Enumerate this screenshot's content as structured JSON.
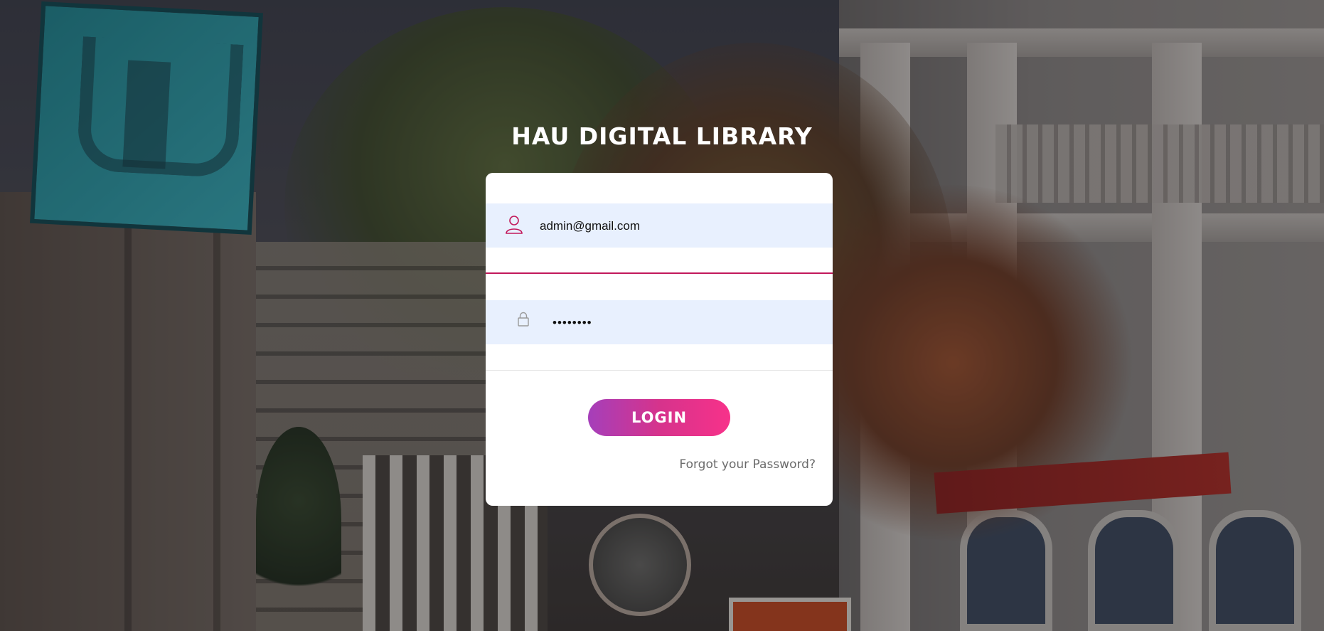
{
  "page": {
    "title": "HAU DIGITAL LIBRARY"
  },
  "login_form": {
    "email": {
      "value": "admin@gmail.com",
      "icon": "user-icon"
    },
    "password": {
      "value": "••••••••",
      "icon": "lock-icon"
    },
    "submit_label": "LOGIN",
    "forgot_password_label": "Forgot your Password?"
  },
  "colors": {
    "accent": "#c2185b",
    "button_gradient_start": "#a53fba",
    "button_gradient_end": "#f7328a",
    "autofill_background": "#e8f0fe"
  }
}
